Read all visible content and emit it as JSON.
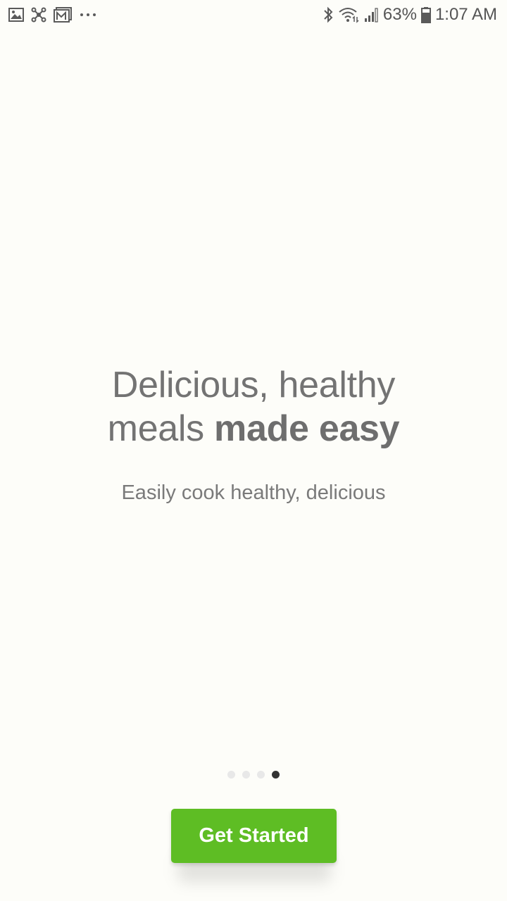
{
  "status_bar": {
    "left_icons": [
      "image-icon",
      "network-icon",
      "gmail-icon",
      "more-dots-icon"
    ],
    "right_icons": [
      "bluetooth-icon",
      "wifi-icon",
      "signal-icon",
      "battery-icon"
    ],
    "battery_percent": "63%",
    "time": "1:07 AM"
  },
  "onboarding": {
    "headline_line1": "Delicious, healthy",
    "headline_line2_regular": "meals ",
    "headline_line2_bold": "made easy",
    "subtext": "Easily cook healthy, delicious",
    "pager": {
      "total": 4,
      "active_index": 3
    },
    "cta_label": "Get Started"
  },
  "colors": {
    "background": "#fdfdf9",
    "accent": "#5ebd24",
    "text": "#737373"
  }
}
